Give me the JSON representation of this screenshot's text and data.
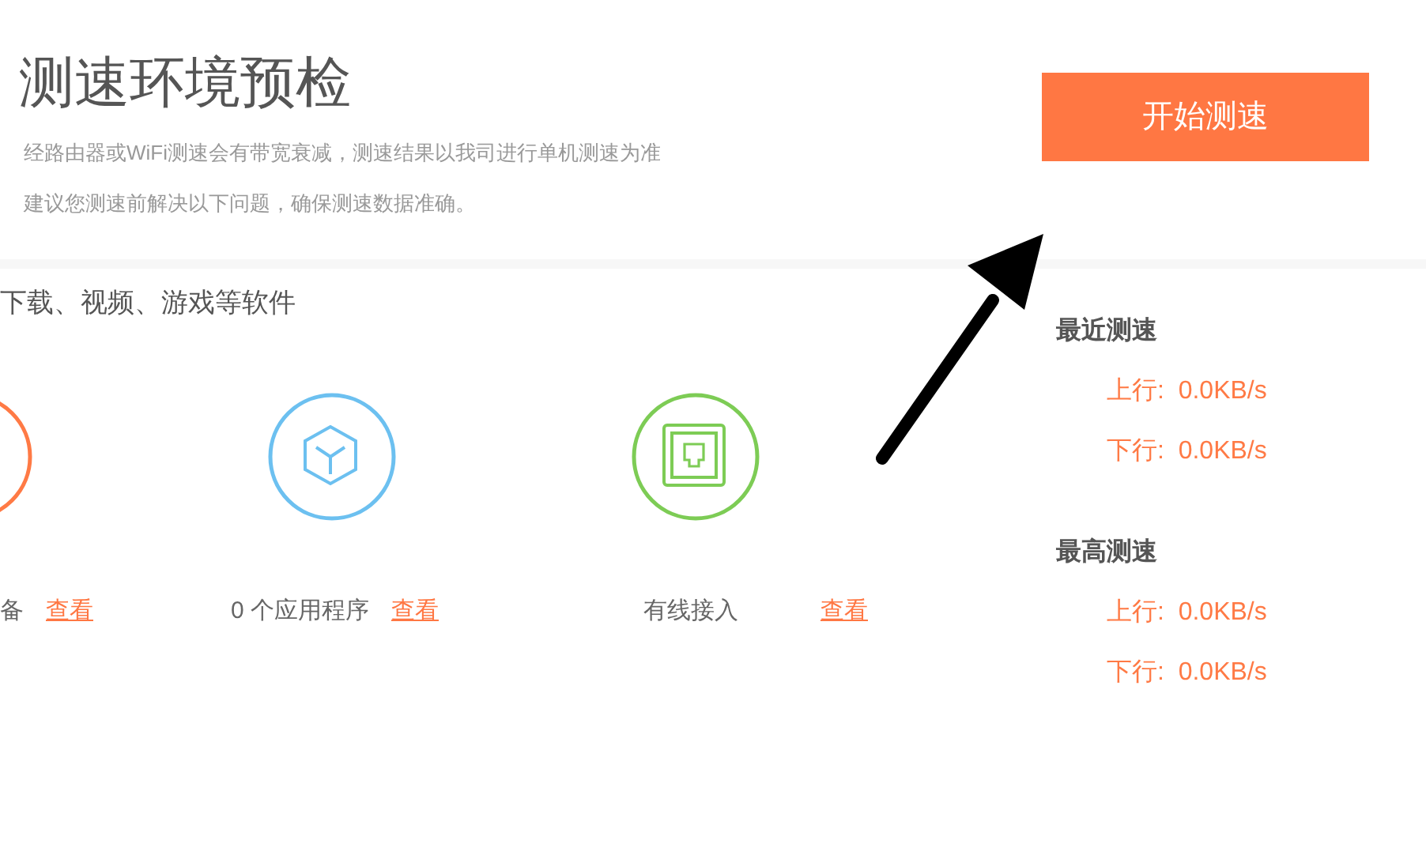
{
  "header": {
    "title": "测速环境预检",
    "notes": [
      "经路由器或WiFi测速会有带宽衰减，测速结果以我司进行单机测速为准",
      "建议您测速前解决以下问题，确保测速数据准确。"
    ]
  },
  "start_button": "开始测速",
  "tip": "下载、视频、游戏等软件",
  "checks": [
    {
      "kind": "device",
      "color": "#ff7a45",
      "label": "备",
      "link": "查看"
    },
    {
      "kind": "app",
      "color": "#6cc0f0",
      "label": "0 个应用程序",
      "link": "查看"
    },
    {
      "kind": "wired",
      "color": "#7dcc55",
      "label": "有线接入",
      "link": "查看"
    }
  ],
  "stats": [
    {
      "title": "最近测速",
      "rows": [
        "上行:  0.0KB/s",
        "下行:  0.0KB/s"
      ]
    },
    {
      "title": "最高测速",
      "rows": [
        "上行:  0.0KB/s",
        "下行:  0.0KB/s"
      ]
    }
  ]
}
